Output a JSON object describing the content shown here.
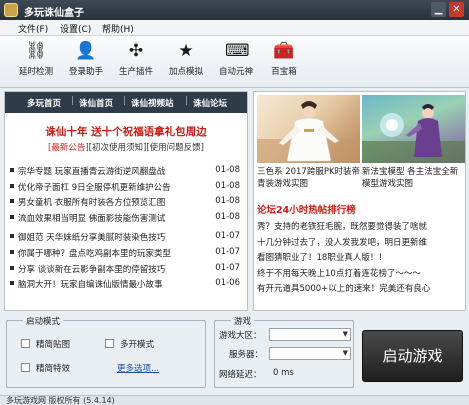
{
  "window": {
    "title": "多玩诛仙盒子",
    "min_glyph": "▁",
    "close_glyph": "✕"
  },
  "menu": {
    "file": "文件(F)",
    "settings": "设置(C)",
    "help": "帮助(H)"
  },
  "toolbar": {
    "items": [
      {
        "label": "延时检测",
        "icon": "plug-icon",
        "glyph": "⛓"
      },
      {
        "label": "登录助手",
        "icon": "person-key-icon",
        "glyph": "👤"
      },
      {
        "label": "生产插件",
        "icon": "puzzle-icon",
        "glyph": "✣"
      },
      {
        "label": "加点模拟",
        "icon": "star-plus-icon",
        "glyph": "★"
      },
      {
        "label": "自动元神",
        "icon": "keyboard-icon",
        "glyph": "⌨"
      },
      {
        "label": "百宝箱",
        "icon": "toolbox-icon",
        "glyph": "🧰"
      }
    ]
  },
  "news_panel": {
    "nav": [
      "多玩首页",
      "诛仙首页",
      "诛仙视频站",
      "诛仙论坛"
    ],
    "nav_sep": "|",
    "promo_title": "诛仙十年 送十个祝福语拿礼包周边",
    "promo_links": {
      "latest": "[最新公告]",
      "first_use": "[初次使用须知]",
      "feedback": "[使用问题反馈]"
    },
    "items": [
      {
        "text": "宗华专题 玩家直播青云游街逆风翻盘战",
        "date": "01-08"
      },
      {
        "text": "优化帝子面杠 9日全服停机更新维护公告",
        "date": "01-08"
      },
      {
        "text": "男女童机 衣服所有时装各方位预览汇图",
        "date": "01-08"
      },
      {
        "text": "流血效果相当明显 佛面影技能伤害测试",
        "date": "01-08"
      },
      {
        "text": "御姐范 天华妹纸分享美腻时装染色技巧",
        "date": "01-07"
      },
      {
        "text": "你属于哪种？盘点吃鸡副本里的玩家类型",
        "date": "01-07"
      },
      {
        "text": "分享 谈谈新在云影争副本里的停留技巧",
        "date": "01-07"
      },
      {
        "text": "脑洞大开！玩家自编诛仙版情最小故事",
        "date": "01-06"
      }
    ]
  },
  "media_panel": {
    "thumb_a": {
      "caption": "三色系 2017跨服PK时装帝青装游戏实图",
      "image": "white-robed-hero-image"
    },
    "thumb_b": {
      "caption": "新法宝模型 各主法宝全新模型游戏实图",
      "image": "character-magic-weapon-image"
    },
    "rank_title": "论坛24小时热帖排行榜",
    "rank_lines": [
      "秀？支持的老铁狂毛腕，既然要觉得装了啥就",
      "十几分钟过去了，没人发我发吧，明日更新维",
      "看图猜职业了！18职业真人版！！",
      "终于不用每天晚上10点打着连花榜了～～～",
      "有开元道具5000+以上的速来！完美还有良心"
    ]
  },
  "launch_settings": {
    "group_title": "启动模式",
    "options": {
      "simple_texture": "精简贴图",
      "multi_open": "多开模式",
      "simple_effects": "精简特效"
    },
    "more": "更多选项..."
  },
  "game_settings": {
    "group_title": "游戏",
    "region_label": "游戏大区：",
    "server_label": "服务器：",
    "ping_label": "网络延迟：",
    "ping_value": "0 ms"
  },
  "launch_button": "启动游戏",
  "statusbar": {
    "text": "多玩游戏网 版权所有 (5.4.14)"
  },
  "colors": {
    "accent_red": "#c81e17",
    "nav_dark": "#2e3c4a",
    "link_blue": "#1a4ea8"
  }
}
